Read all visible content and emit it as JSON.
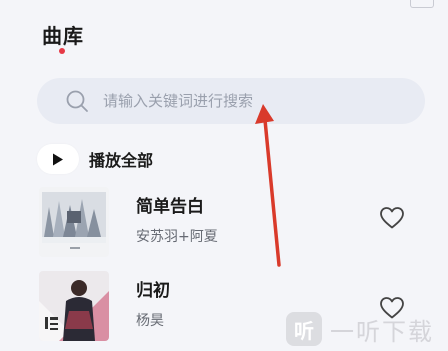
{
  "header": {
    "title": "曲库"
  },
  "search": {
    "placeholder": "请输入关键词进行搜索"
  },
  "play_all": {
    "label": "播放全部"
  },
  "songs": [
    {
      "title": "简单告白",
      "artist": "安苏羽+阿夏"
    },
    {
      "title": "归初",
      "artist": "杨昊"
    }
  ],
  "watermark": {
    "mark": "听",
    "text": "一听下载"
  },
  "colors": {
    "accent_dot": "#e63946",
    "annotation_arrow": "#d93a2b"
  },
  "icons": {
    "search": "search-icon",
    "play": "play-icon",
    "favorite": "heart-outline-icon"
  }
}
